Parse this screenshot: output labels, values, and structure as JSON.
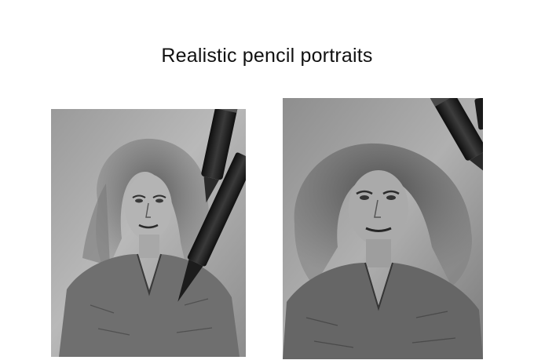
{
  "page": {
    "title": "Realistic pencil portraits"
  },
  "photos": [
    {
      "subject": "pencil-portrait-drawing",
      "tone": "grayscale",
      "props": [
        "pencil",
        "mechanical-pencil"
      ]
    },
    {
      "subject": "pencil-portrait-drawing",
      "tone": "grayscale",
      "props": [
        "pencil"
      ]
    }
  ],
  "colors": {
    "background": "#ffffff",
    "title_text": "#111111",
    "paper_light": "#b8b8b8",
    "paper_dark": "#6a6a6a",
    "graphite": "#2a2a2a"
  }
}
